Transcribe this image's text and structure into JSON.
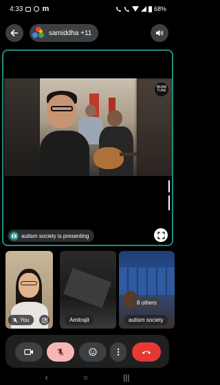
{
  "status_bar": {
    "time": "4:33",
    "status_m": "m",
    "battery": "68%"
  },
  "header": {
    "meeting_label": "samiddha +11"
  },
  "presentation": {
    "presenter_label": "autism society is presenting",
    "watermark": "BEAM TUNE"
  },
  "tiles": [
    {
      "name": "You"
    },
    {
      "name": "Amitrajit"
    },
    {
      "name": "autism society",
      "others": "8 others"
    }
  ],
  "nav": {
    "back": "‹",
    "home": "○",
    "recents": "|||"
  }
}
